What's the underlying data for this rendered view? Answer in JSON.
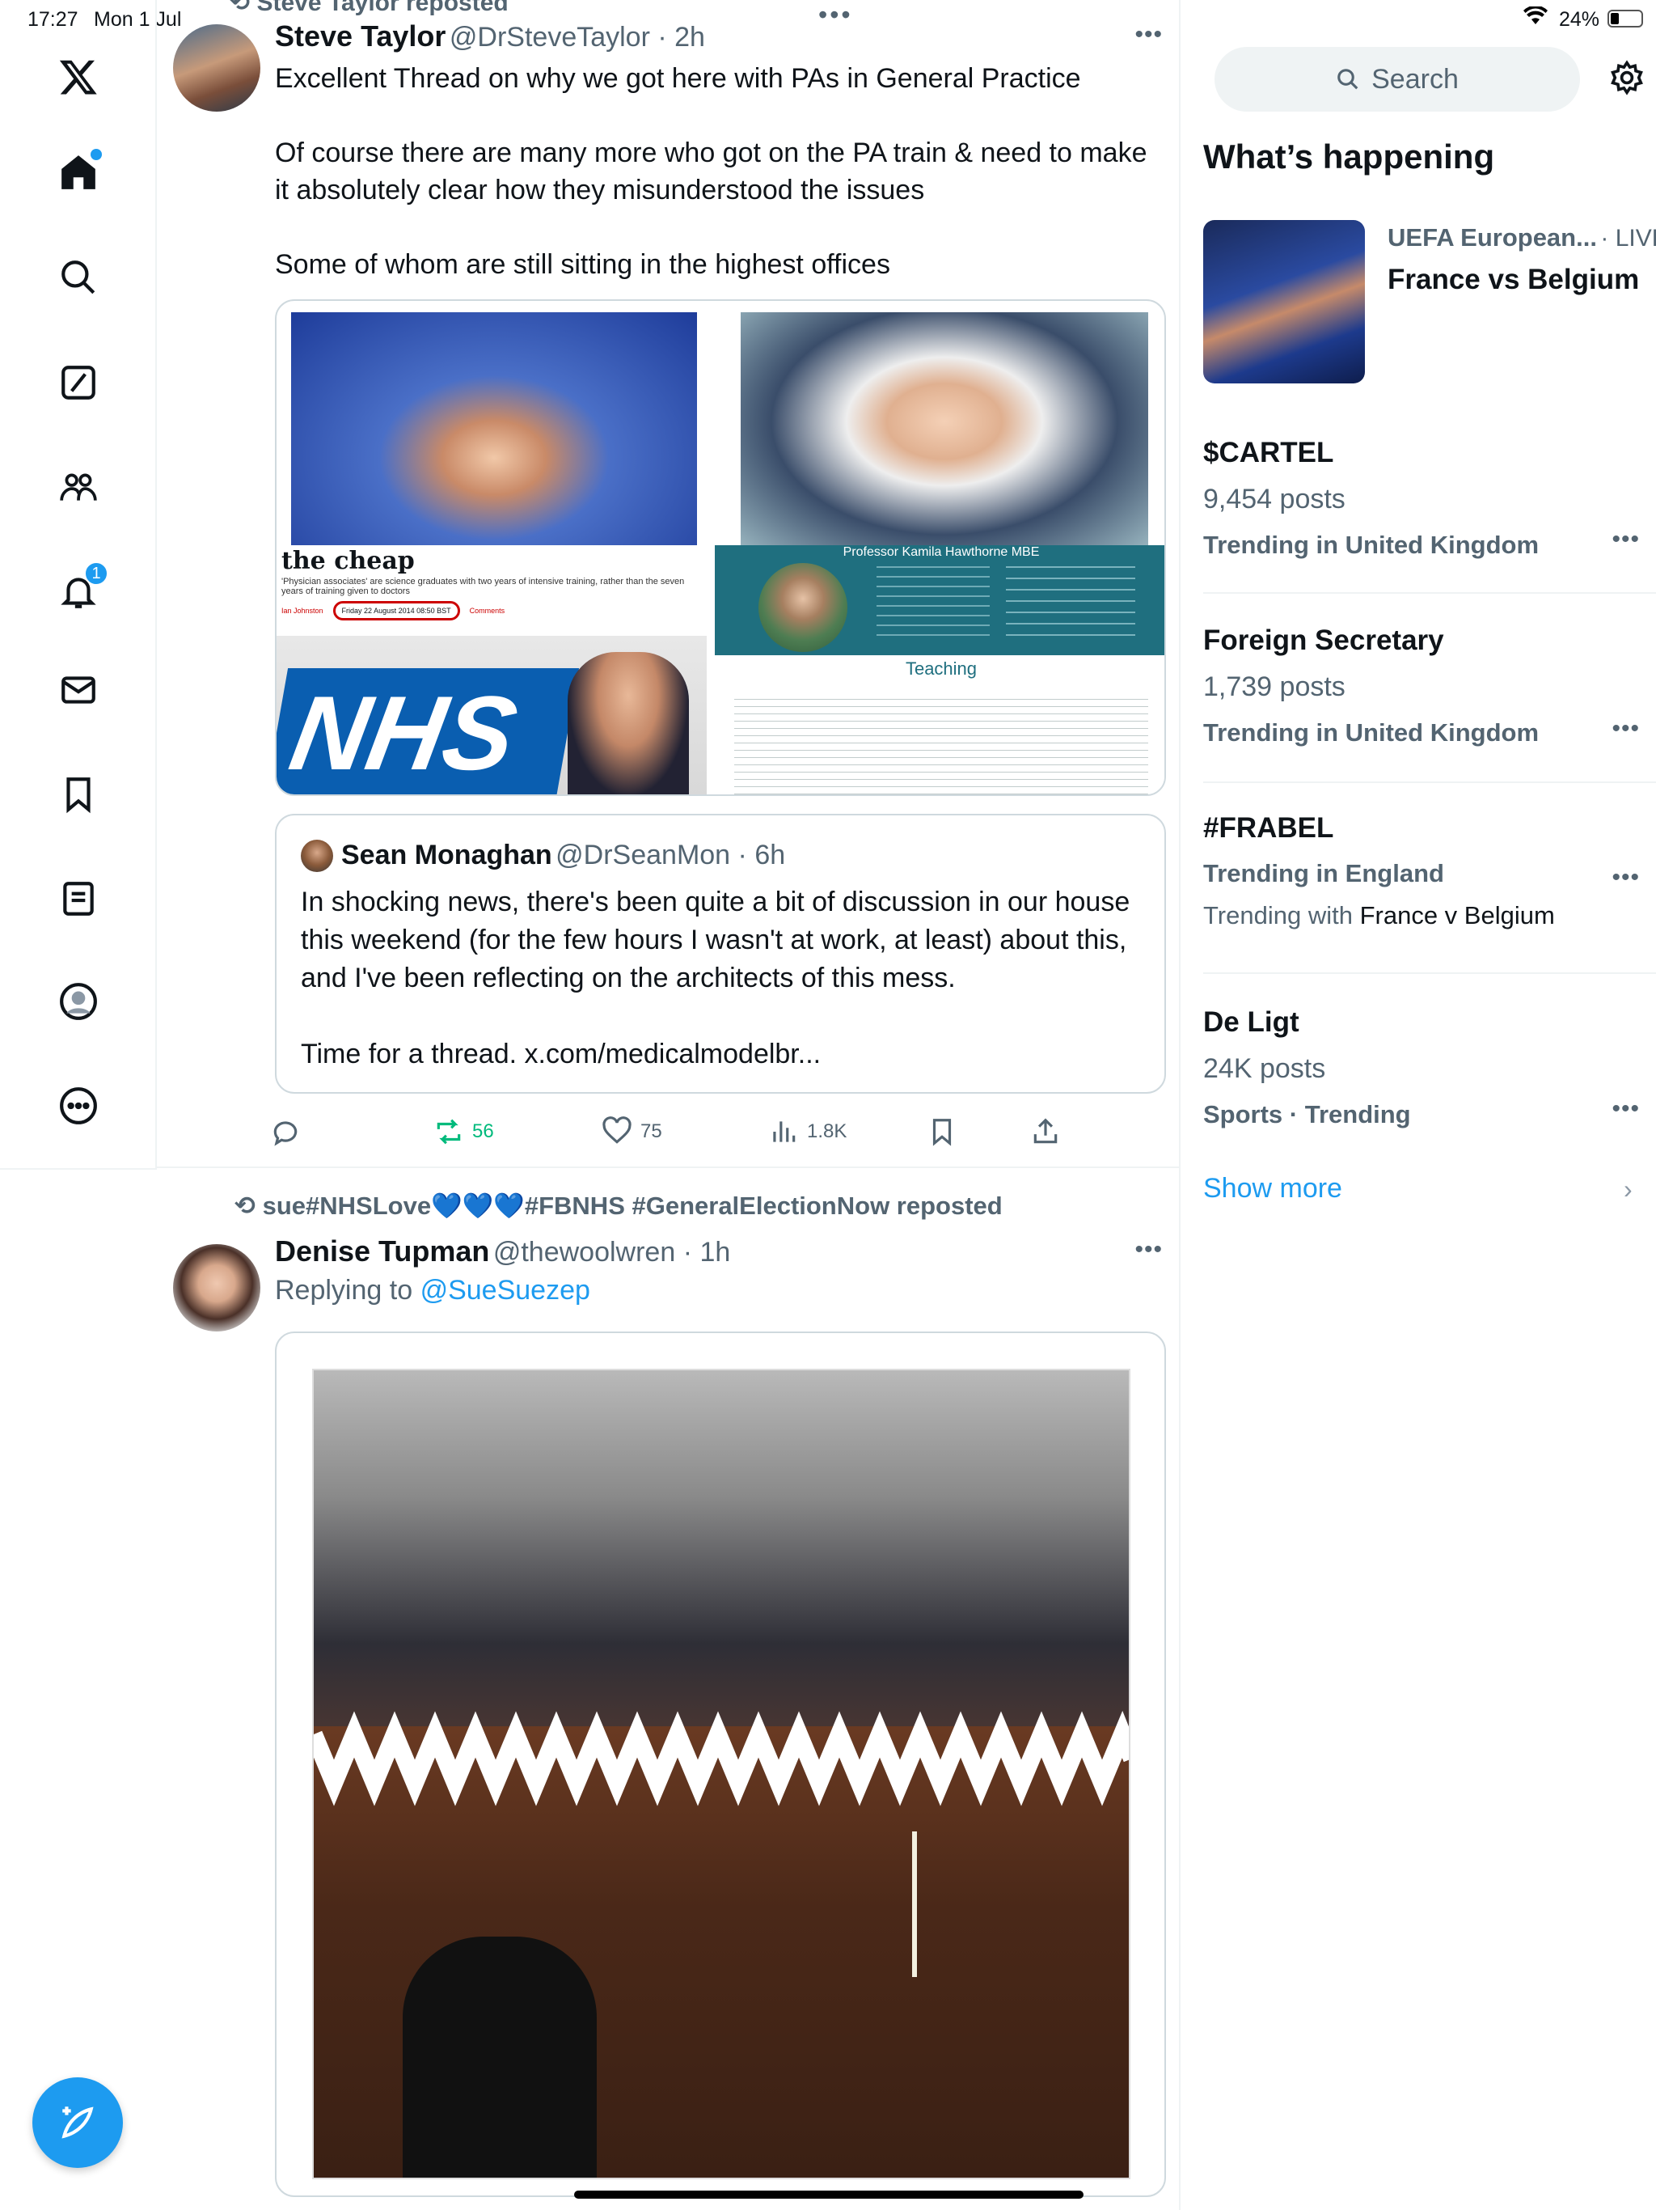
{
  "status_bar": {
    "time": "17:27",
    "date": "Mon 1 Jul",
    "battery": "24%"
  },
  "sidebar": {
    "items": [
      {
        "name": "x-logo-icon"
      },
      {
        "name": "home-icon"
      },
      {
        "name": "search-icon"
      },
      {
        "name": "grok-icon"
      },
      {
        "name": "communities-icon"
      },
      {
        "name": "notifications-icon",
        "badge": "1"
      },
      {
        "name": "messages-icon"
      },
      {
        "name": "bookmarks-icon"
      },
      {
        "name": "lists-icon"
      },
      {
        "name": "profile-icon"
      },
      {
        "name": "more-icon"
      }
    ],
    "compose_icon": "compose-icon"
  },
  "tweet1": {
    "repost_banner": "Steve Taylor reposted",
    "name": "Steve Taylor",
    "handle": "@DrSteveTaylor",
    "time": "2h",
    "text": "Excellent Thread on why we got here with PAs in General Practice\n\nOf course there are many more who got on the PA train & need to make it absolutely clear how they misunderstood the issues\n\nSome of whom are still sitting in the highest offices",
    "media": {
      "clipping_title": "the cheap",
      "clipping_subtitle": "'Physician associates' are science graduates with two years of intensive training, rather than the seven years of training given to doctors",
      "clipping_author": "Ian Johnston",
      "clipping_date": "Friday 22 August 2014 08:50 BST",
      "clipping_comments": "Comments",
      "nhs_logo": "NHS",
      "profile_header": "Professor Kamila Hawthorne MBE",
      "profile_tab": "Teaching"
    },
    "quote": {
      "name": "Sean Monaghan",
      "handle": "@DrSeanMon",
      "time": "6h",
      "text": "In shocking news, there's been quite a bit of discussion in our house this weekend (for the few hours I wasn't at work, at least) about this, and I've been reflecting on the architects of this mess.\n\nTime for a thread. x.com/medicalmodelbr..."
    },
    "actions": {
      "retweets": "56",
      "likes": "75",
      "views": "1.8K"
    }
  },
  "tweet2": {
    "repost_banner": "sue#NHSLove💙💙💙#FBNHS #GeneralElectionNow reposted",
    "name": "Denise Tupman",
    "handle": "@thewoolwren",
    "time": "1h",
    "replying_prefix": "Replying to",
    "replying_to": "@SueSuezep"
  },
  "right": {
    "search_placeholder": "Search",
    "section_title": "What’s happening",
    "featured": {
      "category": "UEFA European...",
      "live": "· LIVE",
      "title": "France vs Belgium"
    },
    "trends": [
      {
        "title": "$CARTEL",
        "posts": "9,454 posts",
        "context": "Trending in United Kingdom"
      },
      {
        "title": "Foreign Secretary",
        "posts": "1,739 posts",
        "context": "Trending in United Kingdom"
      },
      {
        "title": "#FRABEL",
        "context": "Trending in England",
        "with_prefix": "Trending with",
        "with": "France v Belgium"
      },
      {
        "title": "De Ligt",
        "posts": "24K posts",
        "context": "Sports · Trending"
      }
    ],
    "show_more": "Show more"
  },
  "colors": {
    "accent": "#1d9bf0",
    "retweet_green": "#00ba7c",
    "muted": "#536471"
  }
}
